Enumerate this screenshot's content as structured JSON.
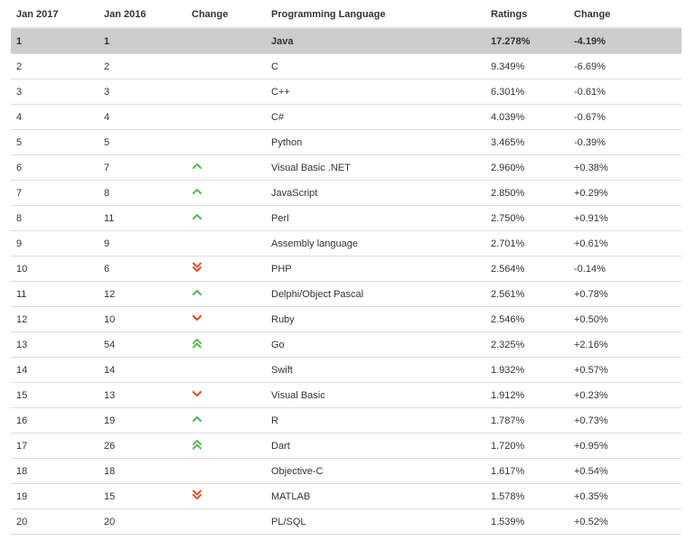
{
  "headers": {
    "jan2017": "Jan 2017",
    "jan2016": "Jan 2016",
    "change": "Change",
    "language": "Programming Language",
    "ratings": "Ratings",
    "change_pct": "Change"
  },
  "colors": {
    "up": "#5cb85c",
    "down": "#d9532c",
    "highlight": "#cccccc"
  },
  "rows": [
    {
      "jan2017": "1",
      "jan2016": "1",
      "trend": "none",
      "language": "Java",
      "rating": "17.278%",
      "change": "-4.19%",
      "highlight": true
    },
    {
      "jan2017": "2",
      "jan2016": "2",
      "trend": "none",
      "language": "C",
      "rating": "9.349%",
      "change": "-6.69%"
    },
    {
      "jan2017": "3",
      "jan2016": "3",
      "trend": "none",
      "language": "C++",
      "rating": "6.301%",
      "change": "-0.61%"
    },
    {
      "jan2017": "4",
      "jan2016": "4",
      "trend": "none",
      "language": "C#",
      "rating": "4.039%",
      "change": "-0.67%"
    },
    {
      "jan2017": "5",
      "jan2016": "5",
      "trend": "none",
      "language": "Python",
      "rating": "3.465%",
      "change": "-0.39%"
    },
    {
      "jan2017": "6",
      "jan2016": "7",
      "trend": "up",
      "language": "Visual Basic .NET",
      "rating": "2.960%",
      "change": "+0.38%"
    },
    {
      "jan2017": "7",
      "jan2016": "8",
      "trend": "up",
      "language": "JavaScript",
      "rating": "2.850%",
      "change": "+0.29%"
    },
    {
      "jan2017": "8",
      "jan2016": "11",
      "trend": "up",
      "language": "Perl",
      "rating": "2.750%",
      "change": "+0.91%"
    },
    {
      "jan2017": "9",
      "jan2016": "9",
      "trend": "none",
      "language": "Assembly language",
      "rating": "2.701%",
      "change": "+0.61%"
    },
    {
      "jan2017": "10",
      "jan2016": "6",
      "trend": "double-down",
      "language": "PHP",
      "rating": "2.564%",
      "change": "-0.14%"
    },
    {
      "jan2017": "11",
      "jan2016": "12",
      "trend": "up",
      "language": "Delphi/Object Pascal",
      "rating": "2.561%",
      "change": "+0.78%"
    },
    {
      "jan2017": "12",
      "jan2016": "10",
      "trend": "down",
      "language": "Ruby",
      "rating": "2.546%",
      "change": "+0.50%"
    },
    {
      "jan2017": "13",
      "jan2016": "54",
      "trend": "double-up",
      "language": "Go",
      "rating": "2.325%",
      "change": "+2.16%"
    },
    {
      "jan2017": "14",
      "jan2016": "14",
      "trend": "none",
      "language": "Swift",
      "rating": "1.932%",
      "change": "+0.57%"
    },
    {
      "jan2017": "15",
      "jan2016": "13",
      "trend": "down",
      "language": "Visual Basic",
      "rating": "1.912%",
      "change": "+0.23%"
    },
    {
      "jan2017": "16",
      "jan2016": "19",
      "trend": "up",
      "language": "R",
      "rating": "1.787%",
      "change": "+0.73%"
    },
    {
      "jan2017": "17",
      "jan2016": "26",
      "trend": "double-up",
      "language": "Dart",
      "rating": "1.720%",
      "change": "+0.95%"
    },
    {
      "jan2017": "18",
      "jan2016": "18",
      "trend": "none",
      "language": "Objective-C",
      "rating": "1.617%",
      "change": "+0.54%"
    },
    {
      "jan2017": "19",
      "jan2016": "15",
      "trend": "double-down",
      "language": "MATLAB",
      "rating": "1.578%",
      "change": "+0.35%"
    },
    {
      "jan2017": "20",
      "jan2016": "20",
      "trend": "none",
      "language": "PL/SQL",
      "rating": "1.539%",
      "change": "+0.52%"
    }
  ]
}
